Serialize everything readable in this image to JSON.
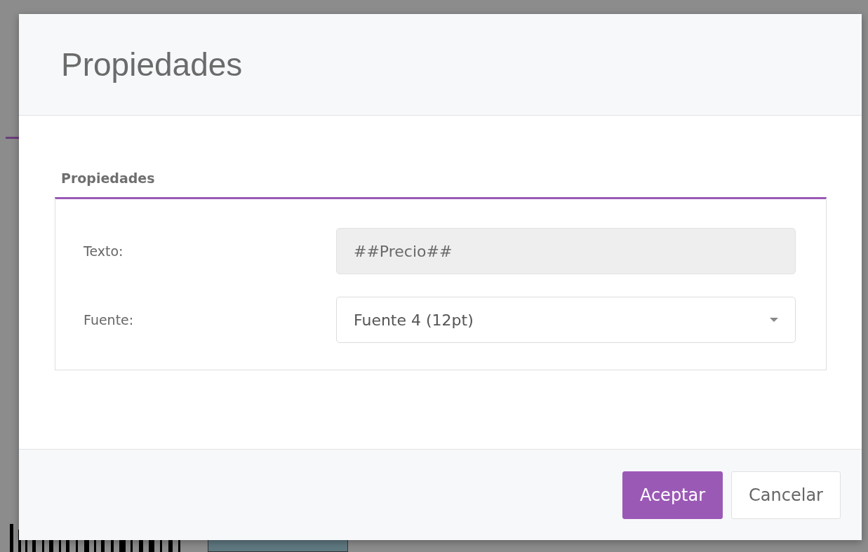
{
  "dialog": {
    "title": "Propiedades",
    "section": {
      "title": "Propiedades",
      "fields": [
        {
          "kind": "text",
          "label": "Texto:",
          "value": "##Precio##",
          "disabled": true
        },
        {
          "kind": "select",
          "label": "Fuente:",
          "value": "Fuente 4 (12pt)"
        }
      ]
    },
    "buttons": [
      {
        "kind": "primary",
        "label": "Aceptar"
      },
      {
        "kind": "secondary",
        "label": "Cancelar"
      }
    ]
  }
}
